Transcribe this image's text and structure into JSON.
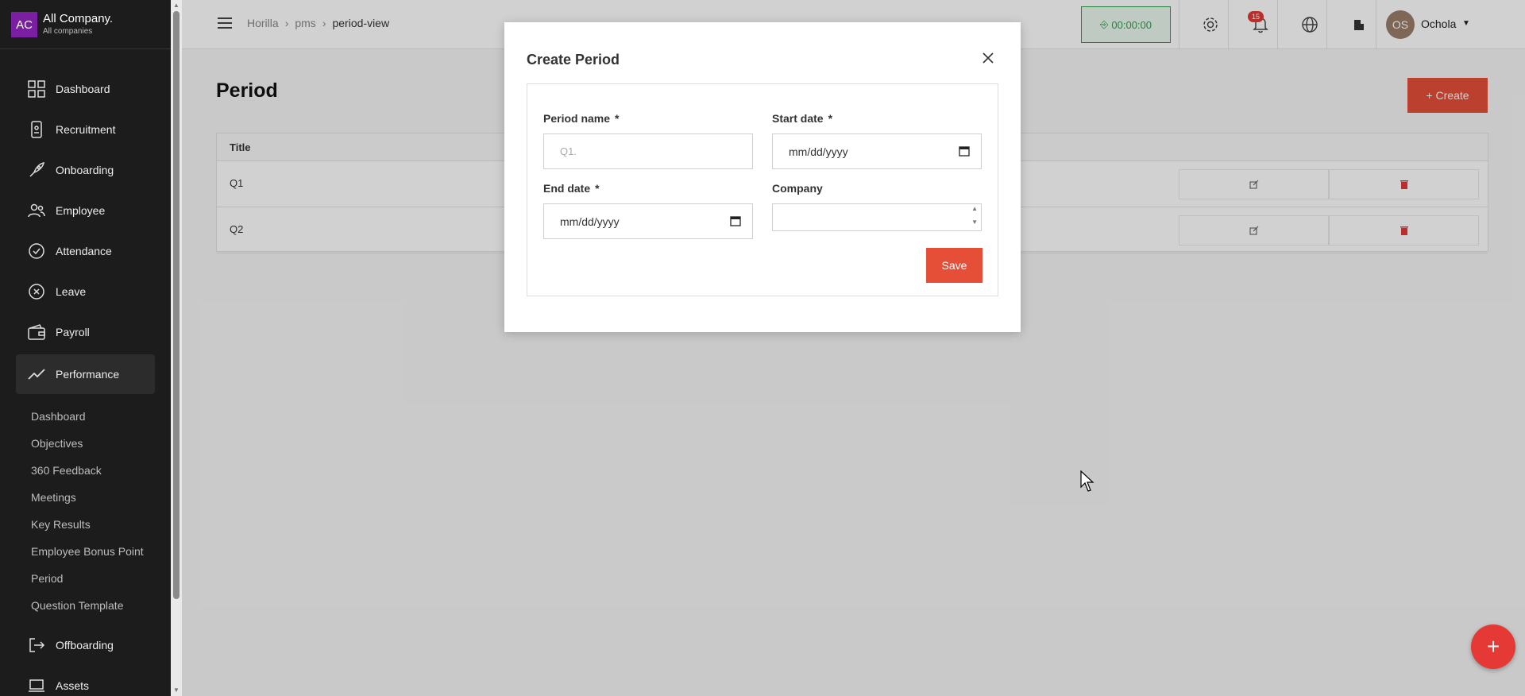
{
  "company": {
    "avatar": "AC",
    "name": "All Company.",
    "sub": "All companies"
  },
  "sidebar": {
    "items": [
      {
        "label": "Dashboard",
        "icon": "dashboard-icon"
      },
      {
        "label": "Recruitment",
        "icon": "recruitment-icon"
      },
      {
        "label": "Onboarding",
        "icon": "rocket-icon"
      },
      {
        "label": "Employee",
        "icon": "people-icon"
      },
      {
        "label": "Attendance",
        "icon": "check-circle-icon"
      },
      {
        "label": "Leave",
        "icon": "x-circle-icon"
      },
      {
        "label": "Payroll",
        "icon": "wallet-icon"
      },
      {
        "label": "Performance",
        "icon": "trend-icon"
      }
    ],
    "subitems": [
      "Dashboard",
      "Objectives",
      "360 Feedback",
      "Meetings",
      "Key Results",
      "Employee Bonus Point",
      "Period",
      "Question Template"
    ],
    "items_after": [
      {
        "label": "Offboarding",
        "icon": "exit-icon"
      },
      {
        "label": "Assets",
        "icon": "laptop-icon"
      }
    ]
  },
  "breadcrumb": [
    "Horilla",
    "pms",
    "period-view"
  ],
  "timer": "00:00:00",
  "notifications": {
    "count": "15"
  },
  "user": {
    "initials": "OS",
    "name": "Ochola"
  },
  "page": {
    "title": "Period",
    "create_label": "+ Create"
  },
  "table": {
    "header": "Title",
    "rows": [
      {
        "title": "Q1"
      },
      {
        "title": "Q2"
      }
    ]
  },
  "modal": {
    "title": "Create Period",
    "period_name_label": "Period name",
    "period_name_placeholder": "Q1.",
    "start_date_label": "Start date",
    "start_date_value": "mm/dd/yyyy",
    "end_date_label": "End date",
    "end_date_value": "mm/dd/yyyy",
    "company_label": "Company",
    "required_mark": "*",
    "save_label": "Save"
  },
  "fab_label": "+",
  "colors": {
    "accent": "#e54f38",
    "sidebar": "#1c1c1c",
    "timer": "#2e9e4a",
    "brand_avatar": "#7b1fa2"
  }
}
